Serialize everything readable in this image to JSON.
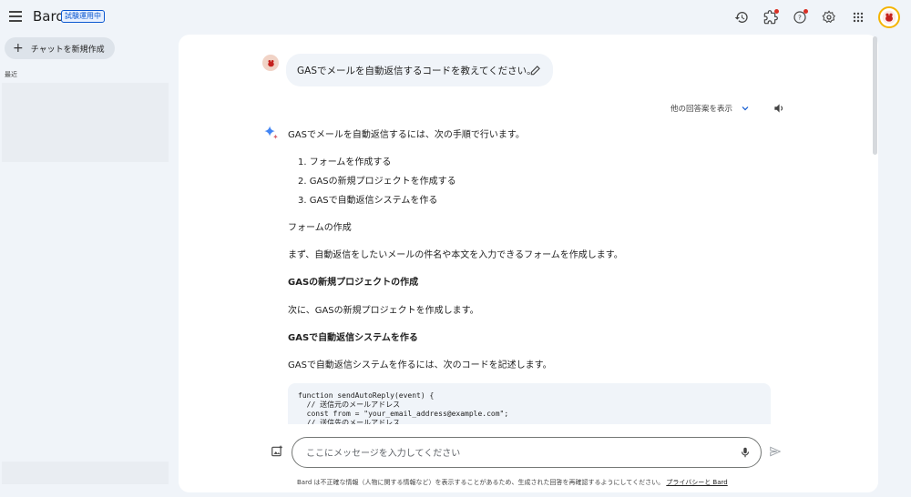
{
  "header": {
    "brand": "Bard",
    "badge": "試験運用中"
  },
  "sidebar": {
    "new_chat_label": "チャットを新規作成",
    "recent_label": "最近"
  },
  "conversation": {
    "user_prompt": "GASでメールを自動返信するコードを教えてください。",
    "other_drafts_label": "他の回答案を表示",
    "response": {
      "intro": "GASでメールを自動返信するには、次の手順で行います。",
      "steps": [
        "1. フォームを作成する",
        "2. GASの新規プロジェクトを作成する",
        "3. GASで自動返信システムを作る"
      ],
      "sections": [
        {
          "heading": "フォームの作成",
          "body": "まず、自動返信をしたいメールの件名や本文を入力できるフォームを作成します。"
        },
        {
          "heading": "GASの新規プロジェクトの作成",
          "body": "次に、GASの新規プロジェクトを作成します。"
        },
        {
          "heading": "GASで自動返信システムを作る",
          "body": "GASで自動返信システムを作るには、次のコードを記述します。"
        }
      ],
      "code": "function sendAutoReply(event) {\n  // 送信元のメールアドレス\n  const from = \"your_email_address@example.com\";\n  // 送信先のメールアドレス"
    }
  },
  "input": {
    "placeholder": "ここにメッセージを入力してください"
  },
  "footer": {
    "disclaimer": "Bard は不正確な情報（人物に関する情報など）を表示することがあるため、生成された回答を再確認するようにしてください。",
    "privacy_link": "プライバシーと Bard"
  },
  "colors": {
    "background": "#f0f4f9",
    "accent": "#0b57d0",
    "notification": "#d93025"
  },
  "icons": [
    "menu-icon",
    "history-icon",
    "extensions-icon",
    "help-icon",
    "settings-icon",
    "apps-grid-icon",
    "account-avatar",
    "edit-icon",
    "chevron-down-icon",
    "speaker-icon",
    "bard-sparkle-icon",
    "image-upload-icon",
    "mic-icon",
    "send-icon"
  ]
}
